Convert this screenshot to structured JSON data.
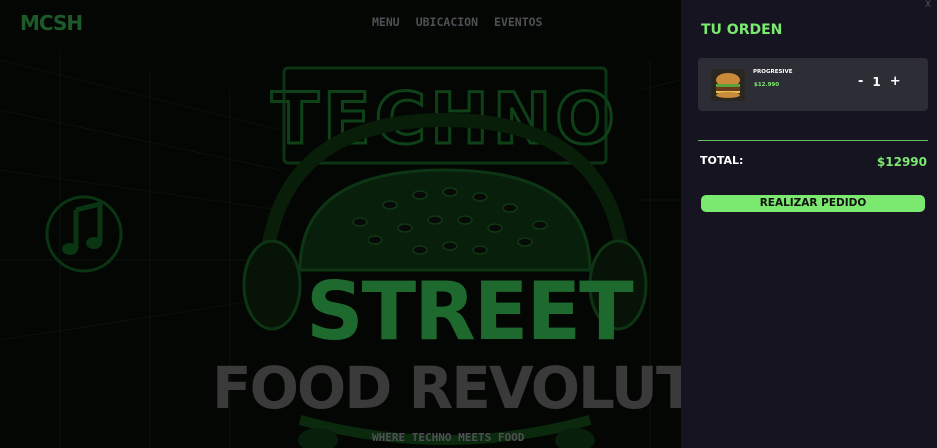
{
  "header": {
    "logo_text": "MCSH",
    "nav": [
      "MENU",
      "UBICACION",
      "EVENTOS"
    ]
  },
  "hero": {
    "sign_text": "TECHNO",
    "headline_1": "STREET",
    "headline_2": "FOOD REVOLUTION",
    "tagline": "WHERE TECHNO MEETS FOOD"
  },
  "cart": {
    "close_label": "X",
    "title": "TU ORDEN",
    "items": [
      {
        "name": "PROGRESIVE",
        "price": "$12.990",
        "qty": "1",
        "minus": "-",
        "plus": "+"
      }
    ],
    "total_label": "TOTAL:",
    "total_value": "$12990",
    "order_button": "REALIZAR PEDIDO"
  },
  "colors": {
    "accent": "#7be86f",
    "panel_bg": "#151420",
    "card_bg": "#2d2d35",
    "hero_green": "#1e6a2e"
  }
}
